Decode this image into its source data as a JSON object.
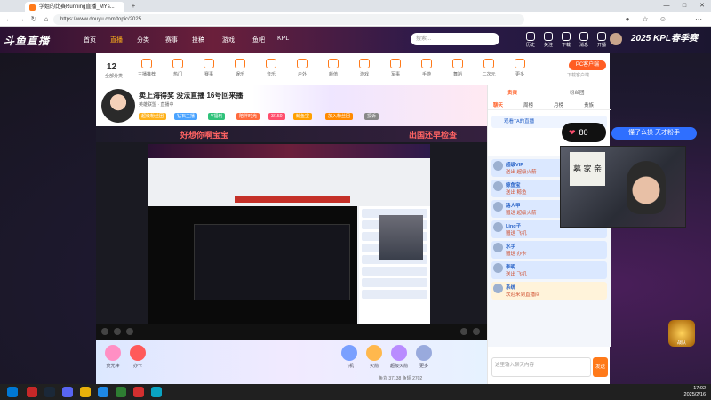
{
  "browser": {
    "tab_title": "学姐的比赛Running直播_MYs...",
    "url": "https://www.douyu.com/topic/2025....",
    "new_tab": "+"
  },
  "header": {
    "logo": "斗鱼直播",
    "nav": [
      "首页",
      "直播",
      "分类",
      "赛事",
      "投稿",
      "游戏",
      "鱼吧",
      "KPL"
    ],
    "search_placeholder": "搜索...",
    "icons": [
      "历史",
      "关注",
      "下载",
      "消息",
      "开播"
    ],
    "kpl_banner": "KPL春季赛",
    "kpl_year": "2025"
  },
  "catbar": {
    "count": "12",
    "count_label": "全部分类",
    "items": [
      "主播推荐",
      "热门",
      "赛事",
      "娱乐",
      "音乐",
      "户外",
      "颜值",
      "游戏",
      "军事",
      "手游",
      "舞蹈",
      "二次元",
      "更多"
    ],
    "pc_button": "PC客户端",
    "pc_sub": "下载客户端"
  },
  "room": {
    "title": "卖上海得奖 没法直播 16号回来播",
    "tags": "英雄联盟 · 直播中",
    "badges": [
      "超级粉丝团",
      "钻石主播",
      "V福利",
      "陪伴时光",
      "3/150",
      "鲸鱼宝",
      "加入粉丝团",
      "投诉"
    ]
  },
  "stream": {
    "overlay_left": "好想你啊宝宝",
    "overlay_right": "出国还早检查"
  },
  "gifts": [
    {
      "name": "荧光棒",
      "color": "#ff8fc4"
    },
    {
      "name": "办卡",
      "color": "#ff5a5a"
    },
    {
      "name": "飞机",
      "color": "#7aa0ff"
    },
    {
      "name": "火箭",
      "color": "#ffb84d"
    },
    {
      "name": "超级火箭",
      "color": "#b98cff"
    },
    {
      "name": "更多",
      "color": "#9ad"
    }
  ],
  "gift_footer": "鱼丸 37138  鱼翅 2702",
  "right_panel": {
    "tabs_top": [
      "贵宾",
      "粉丝团"
    ],
    "tabs_chat": [
      "聊天",
      "周榜",
      "月榜",
      "贵族"
    ],
    "host_label": "观看TA的直播",
    "chat": [
      {
        "name": "超级VIP",
        "text": "送出 超级火箭"
      },
      {
        "name": "鲸鱼宝",
        "text": "送出 鲸鱼"
      },
      {
        "name": "路人甲",
        "text": "赠送 超级火箭"
      },
      {
        "name": "Ling子",
        "text": "赠送 飞机"
      },
      {
        "name": "水手",
        "text": "赠送 办卡"
      },
      {
        "name": "李明",
        "text": "送出 飞机"
      },
      {
        "name": "系统",
        "text": "欢迎来到直播间"
      }
    ],
    "input_placeholder": "这里输入聊天内容",
    "send": "发送"
  },
  "overlays": {
    "heart_count": "80",
    "blue_button": "懂了么操 天才粉手",
    "sign_text": "募 家 亲",
    "emblem": "战队"
  },
  "taskbar": {
    "time": "17:02",
    "date": "2025/2/16"
  }
}
